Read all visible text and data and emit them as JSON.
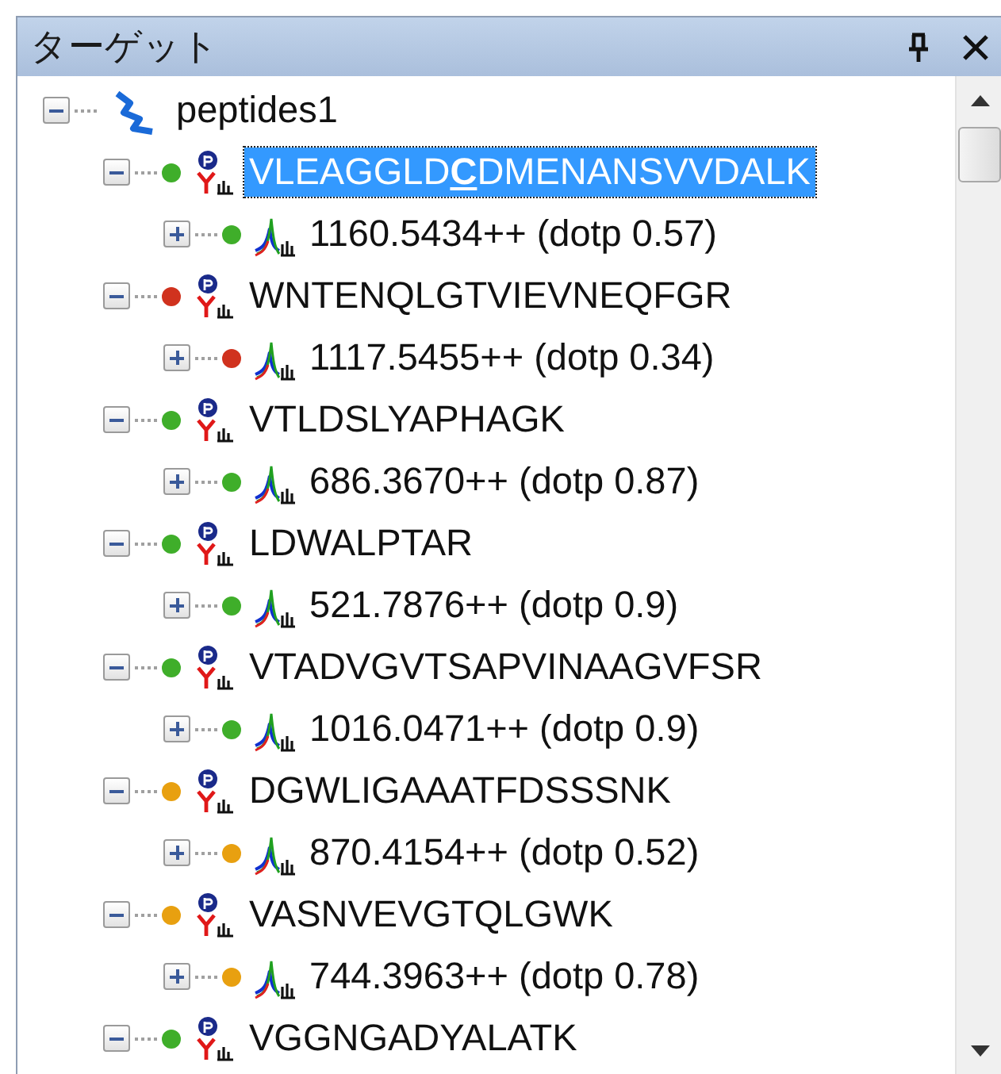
{
  "panel": {
    "title": "ターゲット"
  },
  "tree": [
    {
      "kind": "document",
      "label": "peptides1",
      "expanded": true,
      "children": [
        {
          "kind": "peptide",
          "label": "VLEAGGLD**C**DMENANSVVDALK",
          "selected": true,
          "expanded": true,
          "color": "#3fae2a",
          "children": [
            {
              "kind": "precursor",
              "label": "1160.5434++ (dotp 0.57)",
              "selected": false,
              "expanded": false,
              "color": "#3fae2a"
            }
          ]
        },
        {
          "kind": "peptide",
          "label": "WNTENQLGTVIEVNEQFGR",
          "selected": false,
          "expanded": true,
          "color": "#d0321e",
          "children": [
            {
              "kind": "precursor",
              "label": "1117.5455++ (dotp 0.34)",
              "selected": false,
              "expanded": false,
              "color": "#d0321e"
            }
          ]
        },
        {
          "kind": "peptide",
          "label": "VTLDSLYAPHAGK",
          "selected": false,
          "expanded": true,
          "color": "#3fae2a",
          "children": [
            {
              "kind": "precursor",
              "label": "686.3670++ (dotp 0.87)",
              "selected": false,
              "expanded": false,
              "color": "#3fae2a"
            }
          ]
        },
        {
          "kind": "peptide",
          "label": "LDWALPTAR",
          "selected": false,
          "expanded": true,
          "color": "#3fae2a",
          "children": [
            {
              "kind": "precursor",
              "label": "521.7876++ (dotp 0.9)",
              "selected": false,
              "expanded": false,
              "color": "#3fae2a"
            }
          ]
        },
        {
          "kind": "peptide",
          "label": "VTADVGVTSAPVINAAGVFSR",
          "selected": false,
          "expanded": true,
          "color": "#3fae2a",
          "children": [
            {
              "kind": "precursor",
              "label": "1016.0471++ (dotp 0.9)",
              "selected": false,
              "expanded": false,
              "color": "#3fae2a"
            }
          ]
        },
        {
          "kind": "peptide",
          "label": "DGWLIGAAATFDSSSNK",
          "selected": false,
          "expanded": true,
          "color": "#e8a010",
          "children": [
            {
              "kind": "precursor",
              "label": "870.4154++ (dotp 0.52)",
              "selected": false,
              "expanded": false,
              "color": "#e8a010"
            }
          ]
        },
        {
          "kind": "peptide",
          "label": "VASNVEVGTQLGWK",
          "selected": false,
          "expanded": true,
          "color": "#e8a010",
          "children": [
            {
              "kind": "precursor",
              "label": "744.3963++ (dotp 0.78)",
              "selected": false,
              "expanded": false,
              "color": "#e8a010"
            }
          ]
        },
        {
          "kind": "peptide",
          "label": "VGGNGADYALATK",
          "selected": false,
          "expanded": true,
          "color": "#3fae2a"
        }
      ]
    }
  ]
}
